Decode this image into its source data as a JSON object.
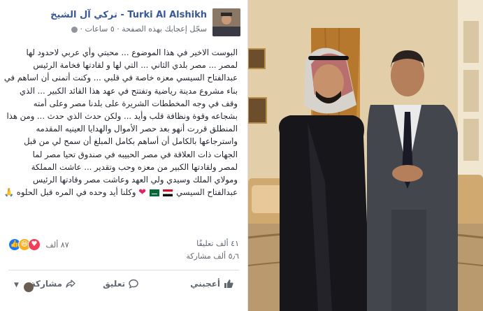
{
  "post": {
    "author": "Turki Al Alshikh - تركي آل الشيخ",
    "meta": "سجّل إعجابك بهذه الصفحة · ٥ ساعات ·",
    "lines": [
      "البوست الاخير في هذا الموضوع ... محبتي وأي عربي لاحدود لها",
      "لمصر ... مصر بلدي الثاني ... التي لها و لقادتها فخامة الرئيس",
      "عبدالفتاح السيسي معزه خاصة في قلبي ... وكنت أتمنى أن اساهم في",
      "بناء مشروع مدينة رياضية وتفتتح في عهد هذا القائد الكبير ... الذي",
      "وقف في وجه المخططات الشريرة على بلدنا مصر وعلى أمته",
      "بشجاعه وقوة ونظافة قلب وأيد ... ولكن حدث الذي حدث ... ومن هذا",
      "المنطلق قررت أنهو بعد حصر الأموال والهدايا العينيه المقدمه",
      "واسترجاعها بالكامل أن أساهم بكامل المبلغ أن سمح لي من قبل",
      "الجهات ذات العلاقة في مصر الحبيبه في صندوق تحيا مصر لما",
      "لمصر ولقادتها الكبير من معزه وحب وتقدير ... عاشت المملكة",
      "ومولاي الملك وسيدي ولي العهد وعاشت مصر وقادتها الرئيس"
    ],
    "last_line": "عبدالفتاح السيسي",
    "last_line_tail": "وكلنا أيد وحده في المره قبل الحلوه"
  },
  "stats": {
    "reactions": "٨٧ ألف",
    "comments": "٤١ ألف تعليقًا",
    "shares": "٥٫٦ ألف مشاركة"
  },
  "actions": {
    "like": "أعجبني",
    "comment": "تعليق",
    "share": "مشاركة"
  },
  "icons": {
    "like": "thumbs-up-icon",
    "comment": "speech-bubble-icon",
    "share": "share-arrow-icon",
    "heart": "❤",
    "pray": "🙏"
  },
  "colors": {
    "author": "#365899",
    "like_blue": "#1877f2",
    "love_red": "#f33e58"
  }
}
